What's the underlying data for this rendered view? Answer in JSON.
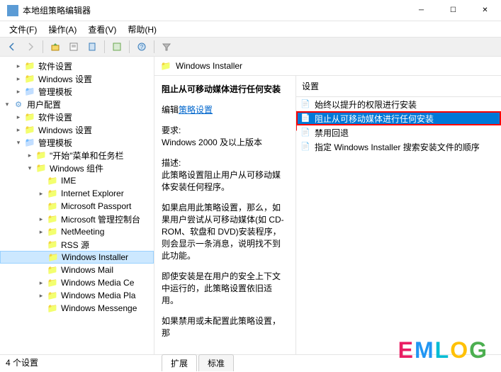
{
  "window": {
    "title": "本地组策略编辑器"
  },
  "menu": {
    "file": "文件(F)",
    "action": "操作(A)",
    "view": "查看(V)",
    "help": "帮助(H)"
  },
  "tree": {
    "software_settings": "软件设置",
    "windows_settings": "Windows 设置",
    "admin_templates": "管理模板",
    "user_config": "用户配置",
    "software_settings2": "软件设置",
    "windows_settings2": "Windows 设置",
    "admin_templates2": "管理模板",
    "start_menu": "\"开始\"菜单和任务栏",
    "windows_components": "Windows 组件",
    "ime": "IME",
    "internet_explorer": "Internet Explorer",
    "microsoft_passport": "Microsoft Passport",
    "microsoft_mgmt": "Microsoft 管理控制台",
    "netmeeting": "NetMeeting",
    "rss": "RSS 源",
    "windows_installer": "Windows Installer",
    "windows_mail": "Windows Mail",
    "windows_media_ce": "Windows Media Ce",
    "windows_media_pla": "Windows Media Pla",
    "windows_messenger": "Windows Messenge"
  },
  "content": {
    "header": "Windows Installer",
    "setting_title": "阻止从可移动媒体进行任何安装",
    "edit_label": "编辑",
    "edit_link": "策略设置",
    "req_label": "要求:",
    "req_value": "Windows 2000 及以上版本",
    "desc_label": "描述:",
    "desc_p1": "此策略设置阻止用户从可移动媒体安装任何程序。",
    "desc_p2": "如果启用此策略设置，那么，如果用户尝试从可移动媒体(如 CD-ROM、软盘和 DVD)安装程序，则会显示一条消息，说明找不到此功能。",
    "desc_p3": "即使安装是在用户的安全上下文中运行的，此策略设置依旧适用。",
    "desc_p4": "如果禁用或未配置此策略设置，那"
  },
  "settings": {
    "header": "设置",
    "items": [
      "始终以提升的权限进行安装",
      "阻止从可移动媒体进行任何安装",
      "禁用回退",
      "指定 Windows Installer 搜索安装文件的顺序"
    ]
  },
  "tabs": {
    "extended": "扩展",
    "standard": "标准"
  },
  "statusbar": {
    "text": "4 个设置"
  },
  "watermark": "EMLOG"
}
